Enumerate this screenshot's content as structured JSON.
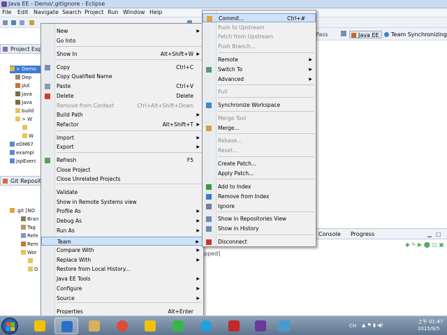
{
  "window": {
    "title": "Java EE - Demo/.gitignore - Eclipse"
  },
  "menubar": [
    "File",
    "Edit",
    "Navigate",
    "Search",
    "Project",
    "Run",
    "Window",
    "Help"
  ],
  "perspectives": {
    "partial": "Pass",
    "java_ee": "Java EE",
    "team_sync": "Team Synchronizing"
  },
  "project_explorer": {
    "tab": "Project Exp",
    "rows": [
      "> Demo",
      "Dep",
      "JAX",
      "Java",
      "Java",
      "build",
      "> W",
      "",
      "W",
      "eDM67",
      "exampl",
      "jspExerc"
    ]
  },
  "git_repos": {
    "tab": "Git Reposit",
    "rows": [
      ".git [NO",
      "Bran",
      "Tag",
      "Refe",
      "Rem",
      "Wor",
      "",
      "D"
    ]
  },
  "bottom_view": {
    "tabs": [
      "Console",
      "Progress"
    ],
    "partial_text": "pped]"
  },
  "context_menu": {
    "items": [
      {
        "label": "New",
        "shortcut": "",
        "submenu": true
      },
      {
        "label": "Go Into",
        "shortcut": ""
      },
      {
        "label": "Show In",
        "shortcut": "Alt+Shift+W",
        "submenu": true
      },
      {
        "label": "Copy",
        "shortcut": "Ctrl+C"
      },
      {
        "label": "Copy Qualified Name",
        "shortcut": ""
      },
      {
        "label": "Paste",
        "shortcut": "Ctrl+V"
      },
      {
        "label": "Delete",
        "shortcut": "Delete"
      },
      {
        "label": "Remove from Context",
        "shortcut": "Ctrl+Alt+Shift+Down"
      },
      {
        "label": "Build Path",
        "shortcut": "",
        "submenu": true
      },
      {
        "label": "Refactor",
        "shortcut": "Alt+Shift+T",
        "submenu": true
      },
      {
        "label": "Import",
        "shortcut": "",
        "submenu": true
      },
      {
        "label": "Export",
        "shortcut": "",
        "submenu": true
      },
      {
        "label": "Refresh",
        "shortcut": "F5"
      },
      {
        "label": "Close Project",
        "shortcut": ""
      },
      {
        "label": "Close Unrelated Projects",
        "shortcut": ""
      },
      {
        "label": "Validate",
        "shortcut": ""
      },
      {
        "label": "Show in Remote Systems view",
        "shortcut": ""
      },
      {
        "label": "Profile As",
        "shortcut": "",
        "submenu": true
      },
      {
        "label": "Debug As",
        "shortcut": "",
        "submenu": true
      },
      {
        "label": "Run As",
        "shortcut": "",
        "submenu": true
      },
      {
        "label": "Team",
        "shortcut": "",
        "submenu": true
      },
      {
        "label": "Compare With",
        "shortcut": "",
        "submenu": true
      },
      {
        "label": "Replace With",
        "shortcut": "",
        "submenu": true
      },
      {
        "label": "Restore from Local History...",
        "shortcut": ""
      },
      {
        "label": "Java EE Tools",
        "shortcut": "",
        "submenu": true
      },
      {
        "label": "Configure",
        "shortcut": "",
        "submenu": true
      },
      {
        "label": "Source",
        "shortcut": "",
        "submenu": true
      },
      {
        "label": "Properties",
        "shortcut": "Alt+Enter"
      }
    ]
  },
  "team_menu": {
    "items": [
      {
        "label": "Commit...",
        "shortcut": "Ctrl+#"
      },
      {
        "label": "Push to Upstream",
        "shortcut": ""
      },
      {
        "label": "Fetch from Upstream",
        "shortcut": ""
      },
      {
        "label": "Push Branch...",
        "shortcut": ""
      },
      {
        "label": "Remote",
        "shortcut": "",
        "submenu": true
      },
      {
        "label": "Switch To",
        "shortcut": "",
        "submenu": true
      },
      {
        "label": "Advanced",
        "shortcut": "",
        "submenu": true
      },
      {
        "label": "Pull",
        "shortcut": ""
      },
      {
        "label": "Synchronize Workspace",
        "shortcut": ""
      },
      {
        "label": "Merge Tool",
        "shortcut": ""
      },
      {
        "label": "Merge...",
        "shortcut": ""
      },
      {
        "label": "Rebase...",
        "shortcut": ""
      },
      {
        "label": "Reset...",
        "shortcut": ""
      },
      {
        "label": "Create Patch...",
        "shortcut": ""
      },
      {
        "label": "Apply Patch...",
        "shortcut": ""
      },
      {
        "label": "Add to Index",
        "shortcut": ""
      },
      {
        "label": "Remove from Index",
        "shortcut": ""
      },
      {
        "label": "Ignore",
        "shortcut": ""
      },
      {
        "label": "Show in Repositories View",
        "shortcut": ""
      },
      {
        "label": "Show in History",
        "shortcut": ""
      },
      {
        "label": "Disconnect",
        "shortcut": ""
      }
    ]
  },
  "taskbar": {
    "apps": [
      "norton-icon",
      "eclipse-icon",
      "file-explorer-icon",
      "chrome-icon",
      "flower-app-icon",
      "line-icon",
      "skype-icon",
      "game-icon",
      "mascot-icon",
      "paint-icon"
    ],
    "clock_time": "上午 01:47",
    "clock_date": "2015/9/5",
    "lang": "CH"
  },
  "colors": {
    "menu_bg": "#f0f0f0",
    "highlight": "#cfe1f7",
    "selection": "#3a7bd5",
    "taskbar": "#6f869f"
  }
}
